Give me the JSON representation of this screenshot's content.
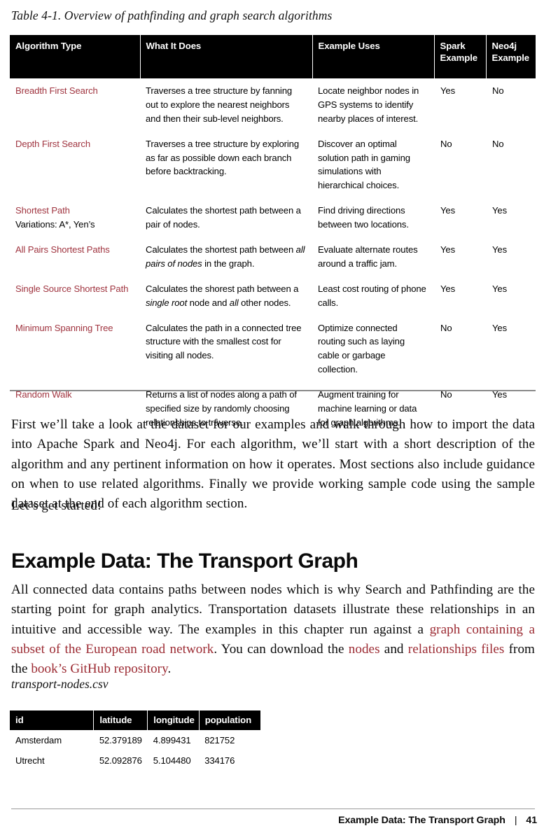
{
  "page": {
    "number": "41",
    "footer_section": "Example Data: The Transport Graph",
    "footer_separator": "|"
  },
  "table_caption": "Table 4-1. Overview of pathfinding and graph search algorithms",
  "algorithms_table": {
    "columns": [
      "Algorithm Type",
      "What It Does",
      "Example Uses",
      "Spark Example",
      "Neo4j Example"
    ],
    "headers": {
      "algorithm_type": "Algorithm Type",
      "what_it_does": "What It Does",
      "example_uses": "Example Uses",
      "spark_example": "Spark Example",
      "neo4j_example": "Neo4j Example"
    },
    "rows": [
      {
        "name": "Breadth First Search",
        "variations": "",
        "what_it_does": "Traverses a tree structure by fanning out to explore the nearest neighbors and then their sub-level neighbors.",
        "example_uses": "Locate neighbor nodes in GPS systems to identify nearby places of interest.",
        "spark": "Yes",
        "neo4j": "No"
      },
      {
        "name": "Depth First Search",
        "variations": "",
        "what_it_does": "Traverses a tree structure by exploring as far as possible down each branch before backtracking.",
        "example_uses": "Discover an optimal solution path in gaming simulations with hierarchical choices.",
        "spark": "No",
        "neo4j": "No"
      },
      {
        "name": "Shortest Path",
        "variations": "Variations: A*, Yen’s",
        "what_it_does": "Calculates the shortest path between a pair of nodes.",
        "example_uses": "Find driving directions between two locations.",
        "spark": "Yes",
        "neo4j": "Yes"
      },
      {
        "name": "All Pairs Shortest Paths",
        "variations": "",
        "what_it_does_pre": "Calculates the shortest path between ",
        "what_it_does_em": "all pairs of nodes",
        "what_it_does_post": " in the graph.",
        "what_it_does": "Calculates the shortest path between all pairs of nodes in the graph.",
        "example_uses": "Evaluate alternate routes around a traffic jam.",
        "spark": "Yes",
        "neo4j": "Yes"
      },
      {
        "name": "Single Source Shortest Path",
        "variations": "",
        "what_it_does_pre": "Calculates the shorest path between a ",
        "what_it_does_em": "single root",
        "what_it_does_mid": " node and ",
        "what_it_does_em2": "all",
        "what_it_does_post": " other nodes.",
        "what_it_does": "Calculates the shorest path between a single root node and all other nodes.",
        "example_uses": "Least cost routing of phone calls.",
        "spark": "Yes",
        "neo4j": "Yes"
      },
      {
        "name": "Minimum Spanning Tree",
        "variations": "",
        "what_it_does": "Calculates the path in a connected tree structure with the smallest cost for visiting all nodes.",
        "example_uses": "Optimize connected routing such as laying cable or garbage collection.",
        "spark": "No",
        "neo4j": "Yes"
      },
      {
        "name": "Random Walk",
        "variations": "",
        "what_it_does": "Returns a list of nodes along a path of specified size by randomly choosing relationships to traverse.",
        "example_uses": "Augment training for machine learning or data for graph algorithms.",
        "spark": "No",
        "neo4j": "Yes"
      }
    ]
  },
  "paragraphs": {
    "intro": "First we’ll take a look at the dataset for our examples and walk through how to import the data into Apache Spark and Neo4j. For each algorithm, we’ll start with a short description of the algorithm and any pertinent information on how it operates. Most sections also include guidance on when to use related algorithms. Finally we provide working sample code using the sample dataset at the end of each algorithm section.",
    "lets_get_started": "Let’s get started!",
    "transport_intro_part1": "All connected data contains paths between nodes which is why Search and Pathfinding are the starting point for graph analytics. Transportation datasets illustrate these relationships in an intuitive and accessible way. The examples in this chapter run against a ",
    "link_graph_subset": "graph containing a subset of the European road network",
    "transport_intro_part2": ". You can download the ",
    "link_nodes": "nodes",
    "transport_intro_part3": " and ",
    "link_relationships": "relationships files",
    "transport_intro_part4": " from the ",
    "link_github": "book’s GitHub repository",
    "transport_intro_part5": "."
  },
  "section_heading": "Example Data: The Transport Graph",
  "csv_filename": "transport-nodes.csv",
  "csv_table": {
    "columns": [
      "id",
      "latitude",
      "longitude",
      "population"
    ],
    "headers": {
      "id": "id",
      "latitude": "latitude",
      "longitude": "longitude",
      "population": "population"
    },
    "rows": [
      {
        "id": "Amsterdam",
        "latitude": "52.379189",
        "longitude": "4.899431",
        "population": "821752"
      },
      {
        "id": "Utrecht",
        "latitude": "52.092876",
        "longitude": "5.104480",
        "population": "334176"
      }
    ]
  },
  "colors": {
    "accent_red": "#A03540",
    "link_red": "#9C2B33",
    "header_bg": "#000000",
    "header_text": "#FFFFFF",
    "body_text": "#000000",
    "rule_gray": "#8A8A8A"
  }
}
